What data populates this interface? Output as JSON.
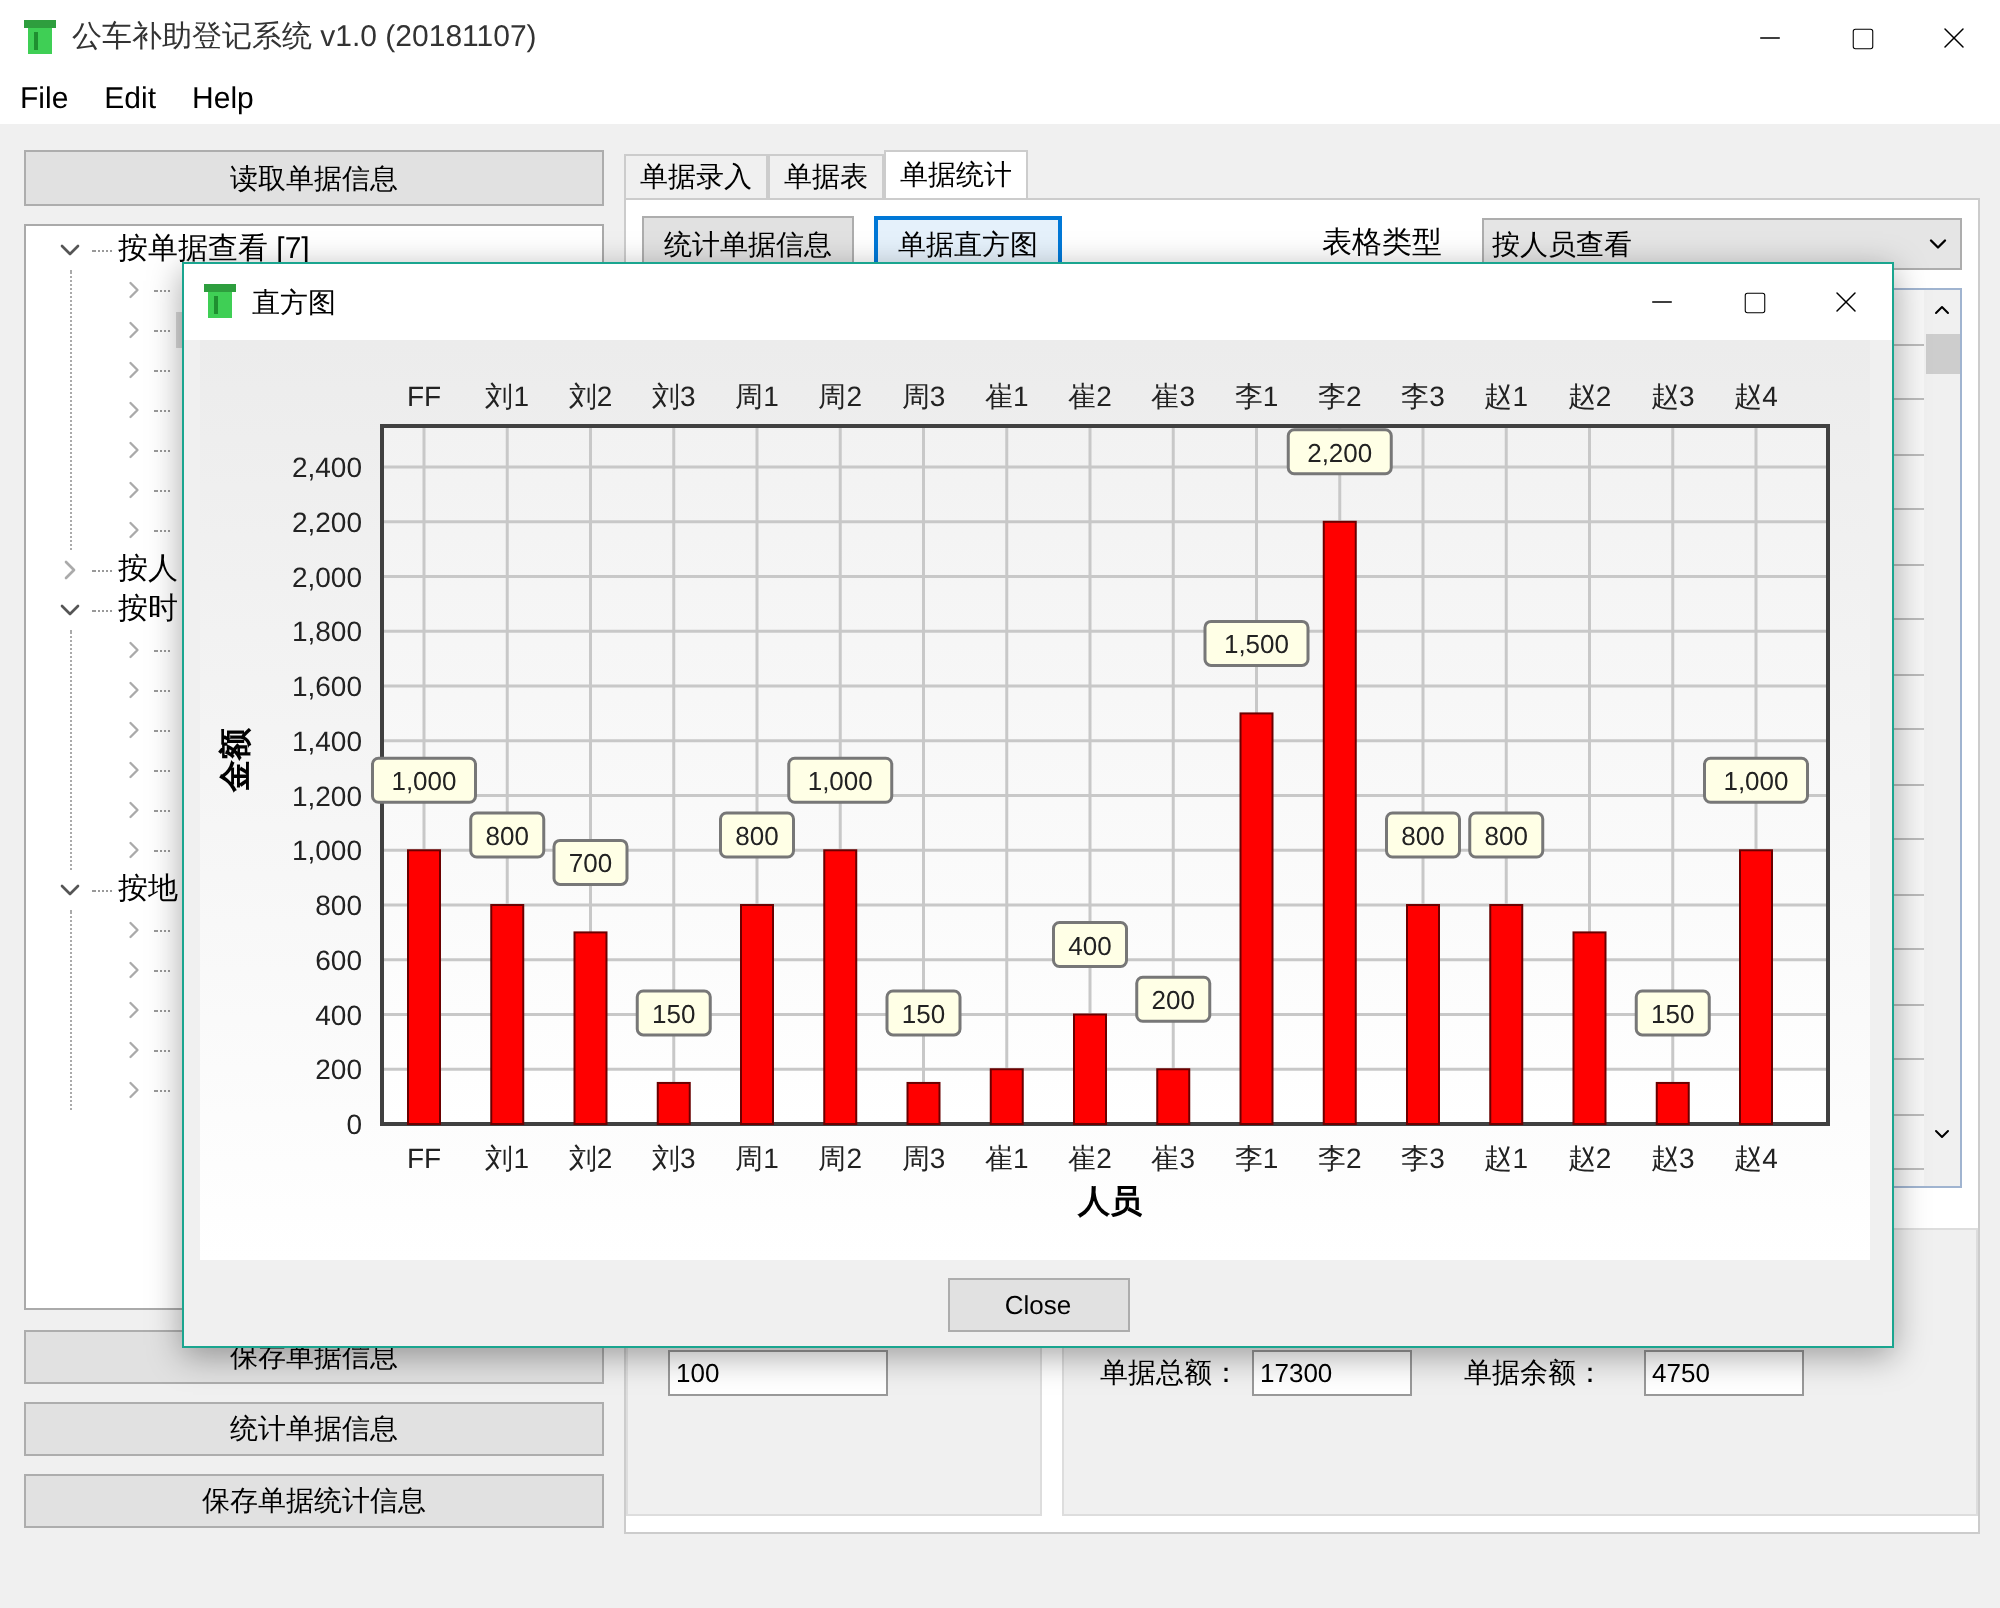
{
  "window": {
    "title": "公车补助登记系统 v1.0 (20181107)"
  },
  "menu": [
    "File",
    "Edit",
    "Help"
  ],
  "left_panel": {
    "load_button": "读取单据信息",
    "tree": [
      {
        "label": "按单据查看 [7]",
        "expanded": true,
        "children": [
          {
            "selected": false
          },
          {
            "selected": true
          },
          {
            "selected": false
          },
          {
            "selected": false
          },
          {
            "selected": false
          },
          {
            "selected": false
          },
          {
            "selected": false
          }
        ]
      },
      {
        "label": "按人",
        "expanded": false
      },
      {
        "label": "按时",
        "expanded": true,
        "children": [
          {
            "selected": false
          },
          {
            "selected": false
          },
          {
            "selected": false
          },
          {
            "selected": false
          },
          {
            "selected": false
          },
          {
            "selected": false
          }
        ]
      },
      {
        "label": "按地",
        "expanded": true,
        "children": [
          {
            "selected": false
          },
          {
            "selected": false
          },
          {
            "selected": false
          },
          {
            "selected": false
          },
          {
            "selected": false
          }
        ]
      }
    ],
    "buttons": [
      "保存单据信息",
      "统计单据信息",
      "保存单据统计信息"
    ]
  },
  "tabs": [
    {
      "label": "单据录入",
      "selected": false
    },
    {
      "label": "单据表",
      "selected": false
    },
    {
      "label": "单据统计",
      "selected": true
    }
  ],
  "stats_tab": {
    "buttons": [
      {
        "label": "统计单据信息",
        "focused": false
      },
      {
        "label": "单据直方图",
        "focused": true
      }
    ],
    "table_type_label": "表格类型",
    "table_type_value": "按人员查看",
    "amount_value": "100",
    "total_label": "单据总额：",
    "total_value": "17300",
    "balance_label": "单据余额：",
    "balance_value": "4750"
  },
  "dialog": {
    "title": "直方图",
    "top_axis_labels": [
      "FF",
      "刘1",
      "刘2",
      "刘3",
      "周1",
      "周2",
      "周3",
      "崔1",
      "崔2",
      "崔3",
      "李1",
      "李2",
      "李3",
      "赵1",
      "赵2",
      "赵3",
      "赵4"
    ],
    "chart_data": {
      "type": "bar",
      "xlabel": "人员",
      "ylabel": "金额",
      "categories": [
        "FF",
        "刘1",
        "刘2",
        "刘3",
        "周1",
        "周2",
        "周3",
        "崔1",
        "崔2",
        "崔3",
        "李1",
        "李2",
        "李3",
        "赵1",
        "赵2",
        "赵3",
        "赵4"
      ],
      "grid": true,
      "series": [
        {
          "color": "#ff0000",
          "values": [
            1000,
            800,
            700,
            150,
            800,
            1000,
            150,
            200,
            400,
            200,
            1500,
            2200,
            800,
            800,
            700,
            150,
            1000
          ]
        }
      ],
      "ylim": [
        0,
        2550
      ],
      "yticks": [
        {
          "value": 0,
          "label": "0"
        },
        {
          "value": 200,
          "label": "200"
        },
        {
          "value": 400,
          "label": "400"
        },
        {
          "value": 600,
          "label": "600"
        },
        {
          "value": 800,
          "label": "800"
        },
        {
          "value": 1000,
          "label": "1,000"
        },
        {
          "value": 1200,
          "label": "1,200"
        },
        {
          "value": 1400,
          "label": "1,400"
        },
        {
          "value": 1600,
          "label": "1,600"
        },
        {
          "value": 1800,
          "label": "1,800"
        },
        {
          "value": 2000,
          "label": "2,000"
        },
        {
          "value": 2200,
          "label": "2,200"
        },
        {
          "value": 2400,
          "label": "2,400"
        }
      ],
      "value_labels": [
        "1,000",
        "800",
        "700",
        "150",
        "800",
        "1,000",
        "150",
        null,
        "400",
        "200",
        "1,500",
        "2,200",
        "800",
        "800",
        null,
        "150",
        "1,000"
      ]
    },
    "close_button": "Close"
  }
}
